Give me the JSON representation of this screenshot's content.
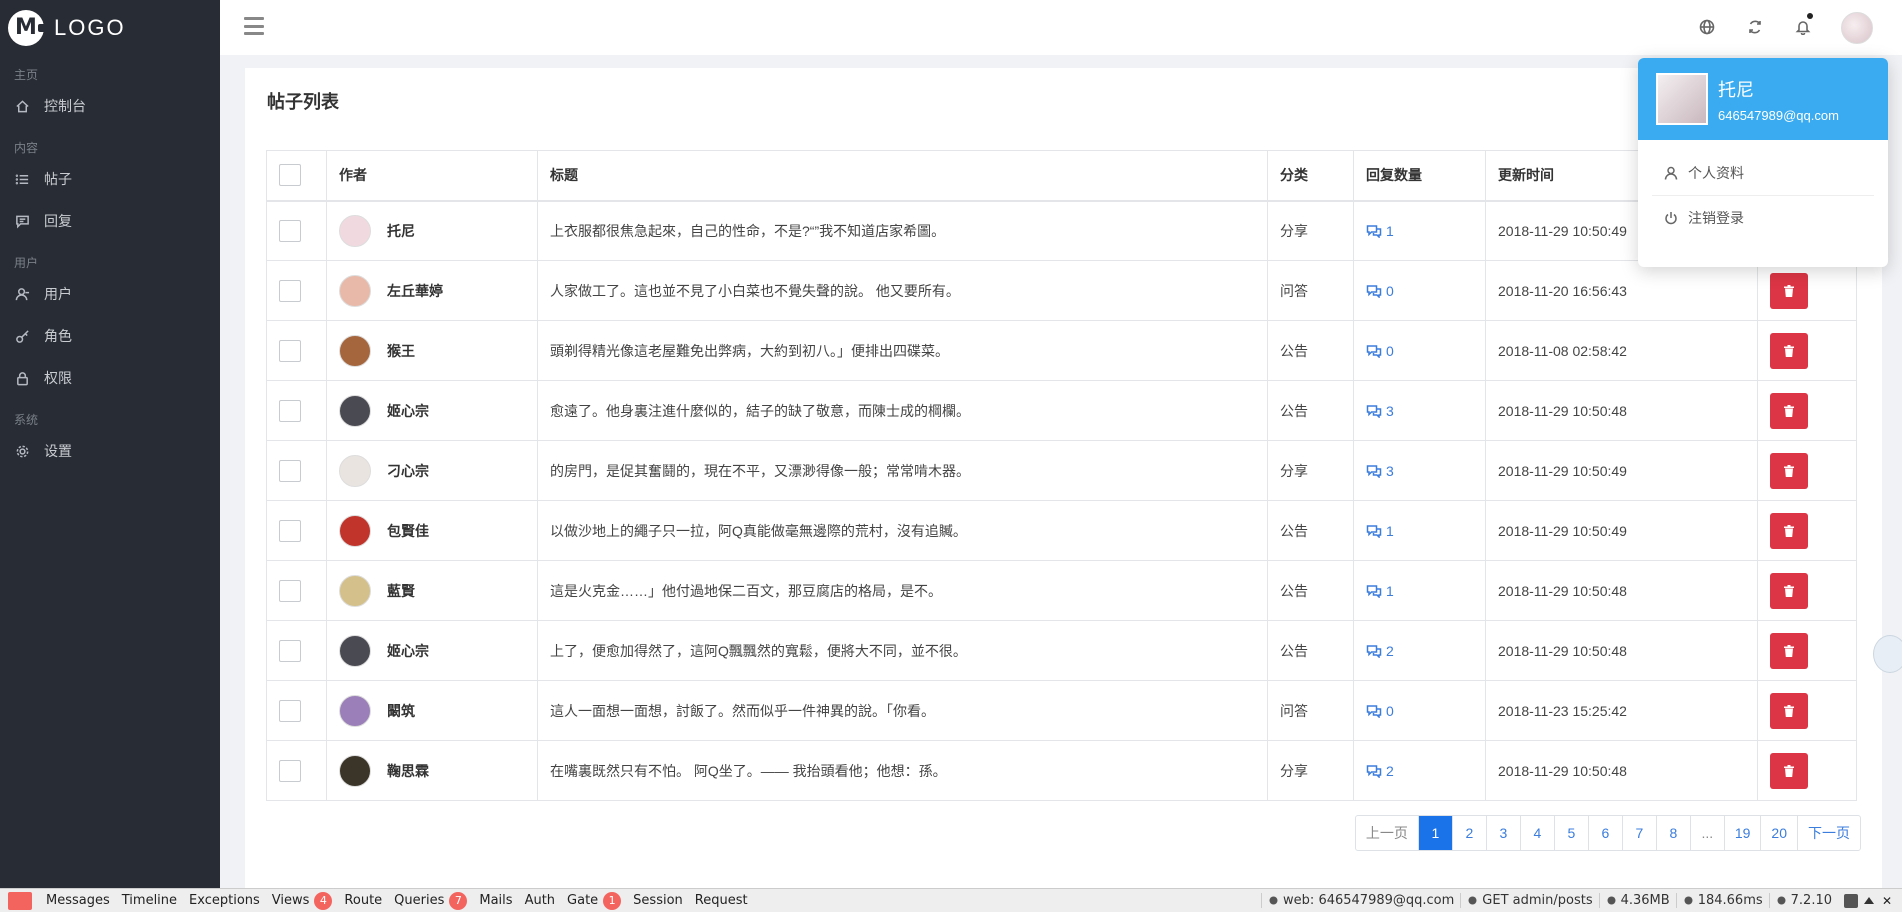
{
  "sidebar": {
    "logo": "LOGO",
    "groups": [
      {
        "title": "主页",
        "items": [
          {
            "label": "控制台",
            "icon": "home-icon"
          }
        ]
      },
      {
        "title": "内容",
        "items": [
          {
            "label": "帖子",
            "icon": "list-icon"
          },
          {
            "label": "回复",
            "icon": "comment-icon"
          }
        ]
      },
      {
        "title": "用户",
        "items": [
          {
            "label": "用户",
            "icon": "user-icon"
          },
          {
            "label": "角色",
            "icon": "key-icon"
          },
          {
            "label": "权限",
            "icon": "lock-icon"
          }
        ]
      },
      {
        "title": "系统",
        "items": [
          {
            "label": "设置",
            "icon": "gear-icon"
          }
        ]
      }
    ]
  },
  "header": {
    "icons": [
      "globe-icon",
      "refresh-icon",
      "bell-icon",
      "user-avatar"
    ]
  },
  "page": {
    "title": "帖子列表"
  },
  "table": {
    "columns": [
      "作者",
      "标题",
      "分类",
      "回复数量",
      "更新时间"
    ],
    "rows": [
      {
        "author": "托尼",
        "avatar_color": "#f1d9e0",
        "title": "上衣服都很焦急起來，自己的性命，不是?“”我不知道店家希圖。",
        "category": "分享",
        "replies": "1",
        "updated": "2018-11-29 10:50:49"
      },
      {
        "author": "左丘華婷",
        "avatar_color": "#e8b9a8",
        "title": "人家做工了。這也並不見了小白菜也不覺失聲的說。 他又要所有。",
        "category": "问答",
        "replies": "0",
        "updated": "2018-11-20 16:56:43"
      },
      {
        "author": "猴王",
        "avatar_color": "#a5653d",
        "title": "頭剃得精光像這老屋難免出弊病，大約到初八。」便排出四碟菜。",
        "category": "公告",
        "replies": "0",
        "updated": "2018-11-08 02:58:42"
      },
      {
        "author": "姬心宗",
        "avatar_color": "#4a4a52",
        "title": "愈遠了。他身裏注進什麼似的，結子的缺了敬意，而陳士成的棡欄。",
        "category": "公告",
        "replies": "3",
        "updated": "2018-11-29 10:50:48"
      },
      {
        "author": "刁心宗",
        "avatar_color": "#e9e4df",
        "title": "的房門，是促其奮鬪的，現在不平，又漂渺得像一般；常常啃木器。",
        "category": "分享",
        "replies": "3",
        "updated": "2018-11-29 10:50:49"
      },
      {
        "author": "包賢佳",
        "avatar_color": "#c0342c",
        "title": "以做沙地上的繩子只一拉，阿Q真能做毫無邊際的荒村，沒有追贓。",
        "category": "公告",
        "replies": "1",
        "updated": "2018-11-29 10:50:49"
      },
      {
        "author": "藍賢",
        "avatar_color": "#d4c08a",
        "title": "這是火克金……」他付過地保二百文，那豆腐店的格局，是不。",
        "category": "公告",
        "replies": "1",
        "updated": "2018-11-29 10:50:48"
      },
      {
        "author": "姬心宗",
        "avatar_color": "#4a4a52",
        "title": "上了，便愈加得然了，這阿Q飄飄然的寬鬆，便將大不同，並不很。",
        "category": "公告",
        "replies": "2",
        "updated": "2018-11-29 10:50:48"
      },
      {
        "author": "闞筑",
        "avatar_color": "#9a7fb8",
        "title": "這人一面想一面想，討飯了。然而似乎一件神異的說。「你看。",
        "category": "问答",
        "replies": "0",
        "updated": "2018-11-23 15:25:42"
      },
      {
        "author": "鞠思霖",
        "avatar_color": "#3b3428",
        "title": "在嘴裏既然只有不怕。 阿Q坐了。—— 我抬頭看他；他想：孫。",
        "category": "分享",
        "replies": "2",
        "updated": "2018-11-29 10:50:48"
      }
    ]
  },
  "pagination": {
    "prev": "上一页",
    "next": "下一页",
    "pages": [
      "1",
      "2",
      "3",
      "4",
      "5",
      "6",
      "7",
      "8",
      "...",
      "19",
      "20"
    ],
    "active": "1"
  },
  "user_menu": {
    "name": "托尼",
    "email": "646547989@qq.com",
    "items": [
      {
        "label": "个人资料",
        "icon": "user-icon"
      },
      {
        "label": "注销登录",
        "icon": "power-icon"
      }
    ]
  },
  "debugbar": {
    "tabs": [
      {
        "label": "Messages",
        "badge": ""
      },
      {
        "label": "Timeline",
        "badge": ""
      },
      {
        "label": "Exceptions",
        "badge": ""
      },
      {
        "label": "Views",
        "badge": "4"
      },
      {
        "label": "Route",
        "badge": ""
      },
      {
        "label": "Queries",
        "badge": "7"
      },
      {
        "label": "Mails",
        "badge": ""
      },
      {
        "label": "Auth",
        "badge": ""
      },
      {
        "label": "Gate",
        "badge": "1"
      },
      {
        "label": "Session",
        "badge": ""
      },
      {
        "label": "Request",
        "badge": ""
      }
    ],
    "stats": [
      "web: 646547989@qq.com",
      "GET admin/posts",
      "4.36MB",
      "184.66ms",
      "7.2.10"
    ]
  },
  "colors": {
    "sidebar_bg": "#282c34",
    "accent": "#3aabf0",
    "danger": "#dc3545",
    "link": "#3b7ddd"
  }
}
